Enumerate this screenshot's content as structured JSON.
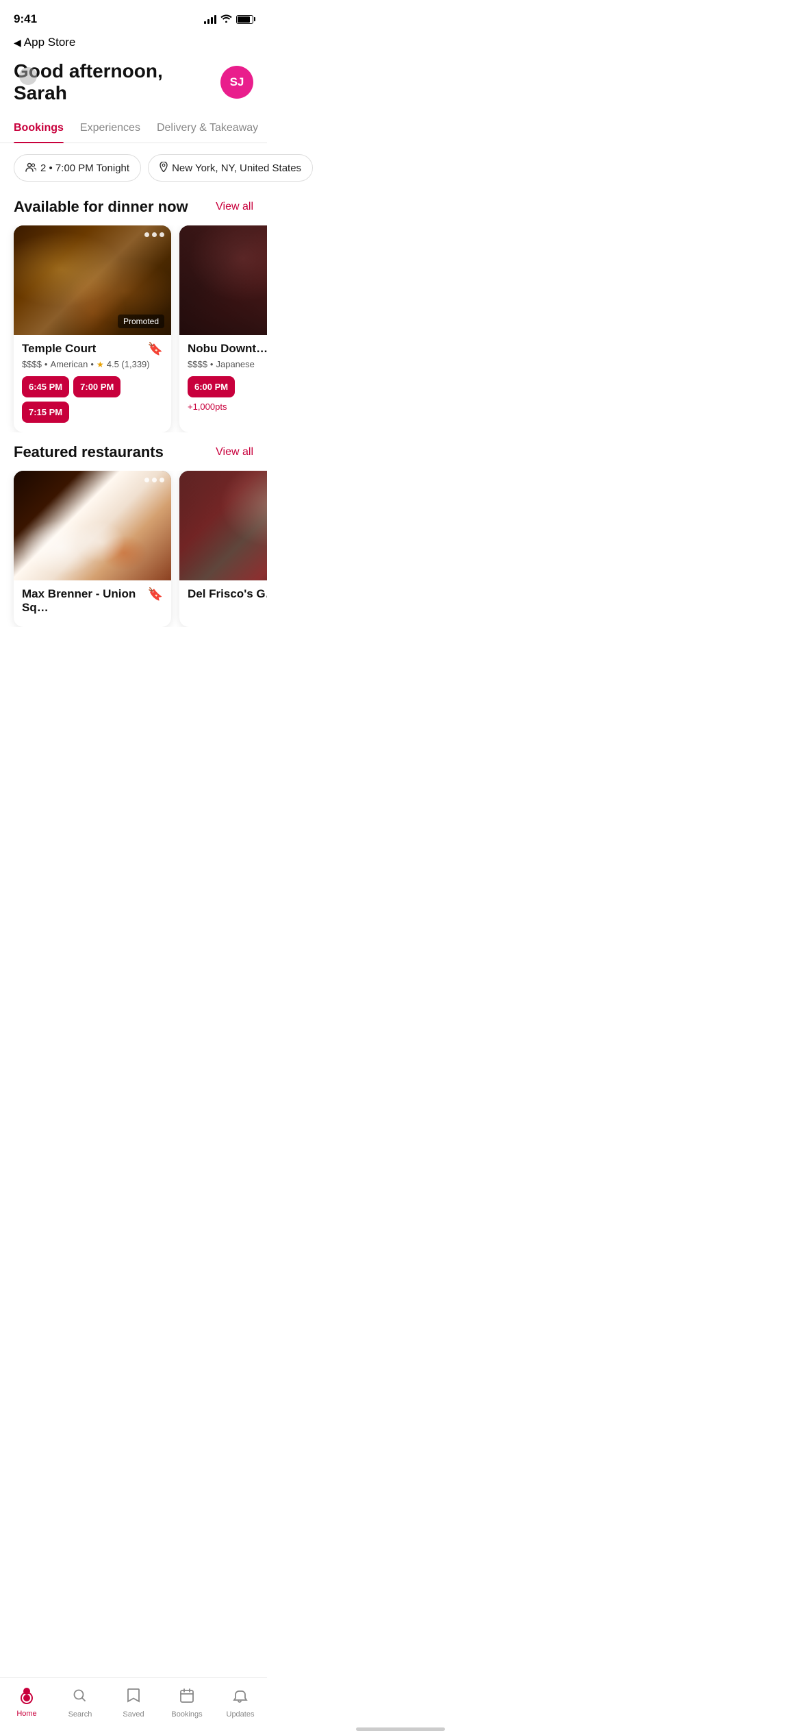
{
  "status": {
    "time": "9:41",
    "back_label": "App Store"
  },
  "header": {
    "greeting": "Good afternoon, Sarah",
    "avatar_initials": "SJ"
  },
  "tabs": [
    {
      "label": "Bookings",
      "active": true
    },
    {
      "label": "Experiences",
      "active": false
    },
    {
      "label": "Delivery & Takeaway",
      "active": false
    }
  ],
  "filters": {
    "guests": "2 • 7:00 PM Tonight",
    "location": "New York, NY, United States"
  },
  "dinner_section": {
    "title": "Available for dinner now",
    "view_all": "View all",
    "restaurants": [
      {
        "name": "Temple Court",
        "price": "$$$$",
        "cuisine": "American",
        "rating": "4.5",
        "reviews": "1,339",
        "promoted": true,
        "times": [
          "6:45 PM",
          "7:00 PM",
          "7:15 PM"
        ],
        "points": null
      },
      {
        "name": "Nobu Downt…",
        "price": "$$$$",
        "cuisine": "Japanese",
        "rating": null,
        "reviews": null,
        "promoted": false,
        "times": [
          "6:00 PM"
        ],
        "points": "+1,000pts"
      }
    ]
  },
  "featured_section": {
    "title": "Featured restaurants",
    "view_all": "View all",
    "restaurants": [
      {
        "name": "Max Brenner - Union Sq…",
        "price": null,
        "cuisine": null,
        "rating": null,
        "reviews": null,
        "promoted": false,
        "times": [],
        "points": null
      },
      {
        "name": "Del Frisco's G…",
        "price": null,
        "cuisine": null,
        "rating": null,
        "reviews": null,
        "promoted": false,
        "times": [],
        "points": null
      }
    ]
  },
  "bottom_nav": [
    {
      "label": "Home",
      "icon": "⬤",
      "active": true
    },
    {
      "label": "Search",
      "icon": "search",
      "active": false
    },
    {
      "label": "Saved",
      "icon": "bookmark",
      "active": false
    },
    {
      "label": "Bookings",
      "icon": "calendar",
      "active": false
    },
    {
      "label": "Updates",
      "icon": "bell",
      "active": false
    }
  ]
}
